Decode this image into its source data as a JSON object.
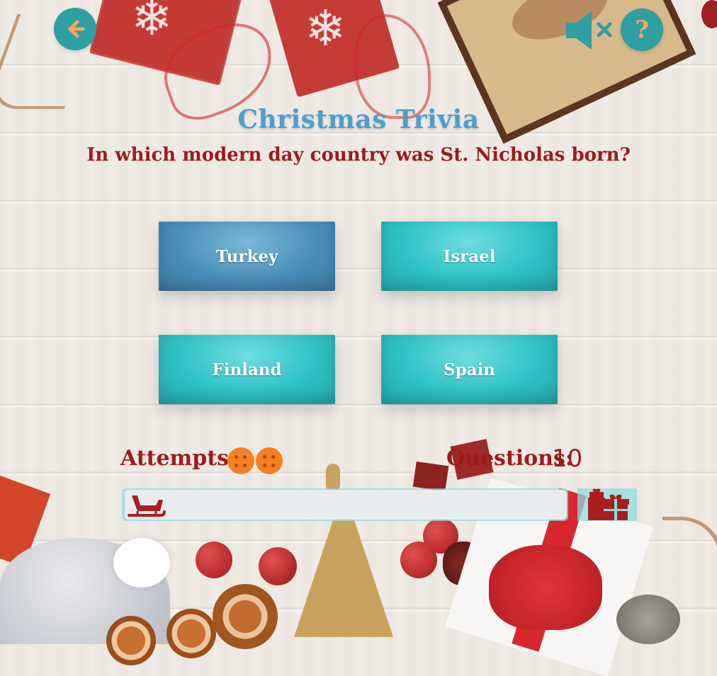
{
  "header": {
    "back_icon": "arrow-left-icon",
    "mute_icon": "volume-mute-icon",
    "help_label": "?"
  },
  "game": {
    "title": "Christmas Trivia",
    "question": "In which modern day country was St. Nicholas born?",
    "answers": [
      {
        "label": "Turkey",
        "color": "#4a8fb8"
      },
      {
        "label": "Israel",
        "color": "#2fc2c6"
      },
      {
        "label": "Finland",
        "color": "#2fc2c6"
      },
      {
        "label": "Spain",
        "color": "#2fc2c6"
      }
    ]
  },
  "status": {
    "attempts_label": "Attempts:",
    "attempts_remaining": 2,
    "questions_label": "Questions:",
    "questions_count": "10"
  },
  "progress": {
    "value_fraction": 0,
    "start_icon": "sleigh-icon",
    "goal_icon": "gifts-icon"
  },
  "colors": {
    "title": "#4b9fcf",
    "text_red": "#9b1c1c",
    "button_teal": "#2e9fa3",
    "icon_orange": "#f5a65b",
    "life_orange": "#f58021"
  }
}
